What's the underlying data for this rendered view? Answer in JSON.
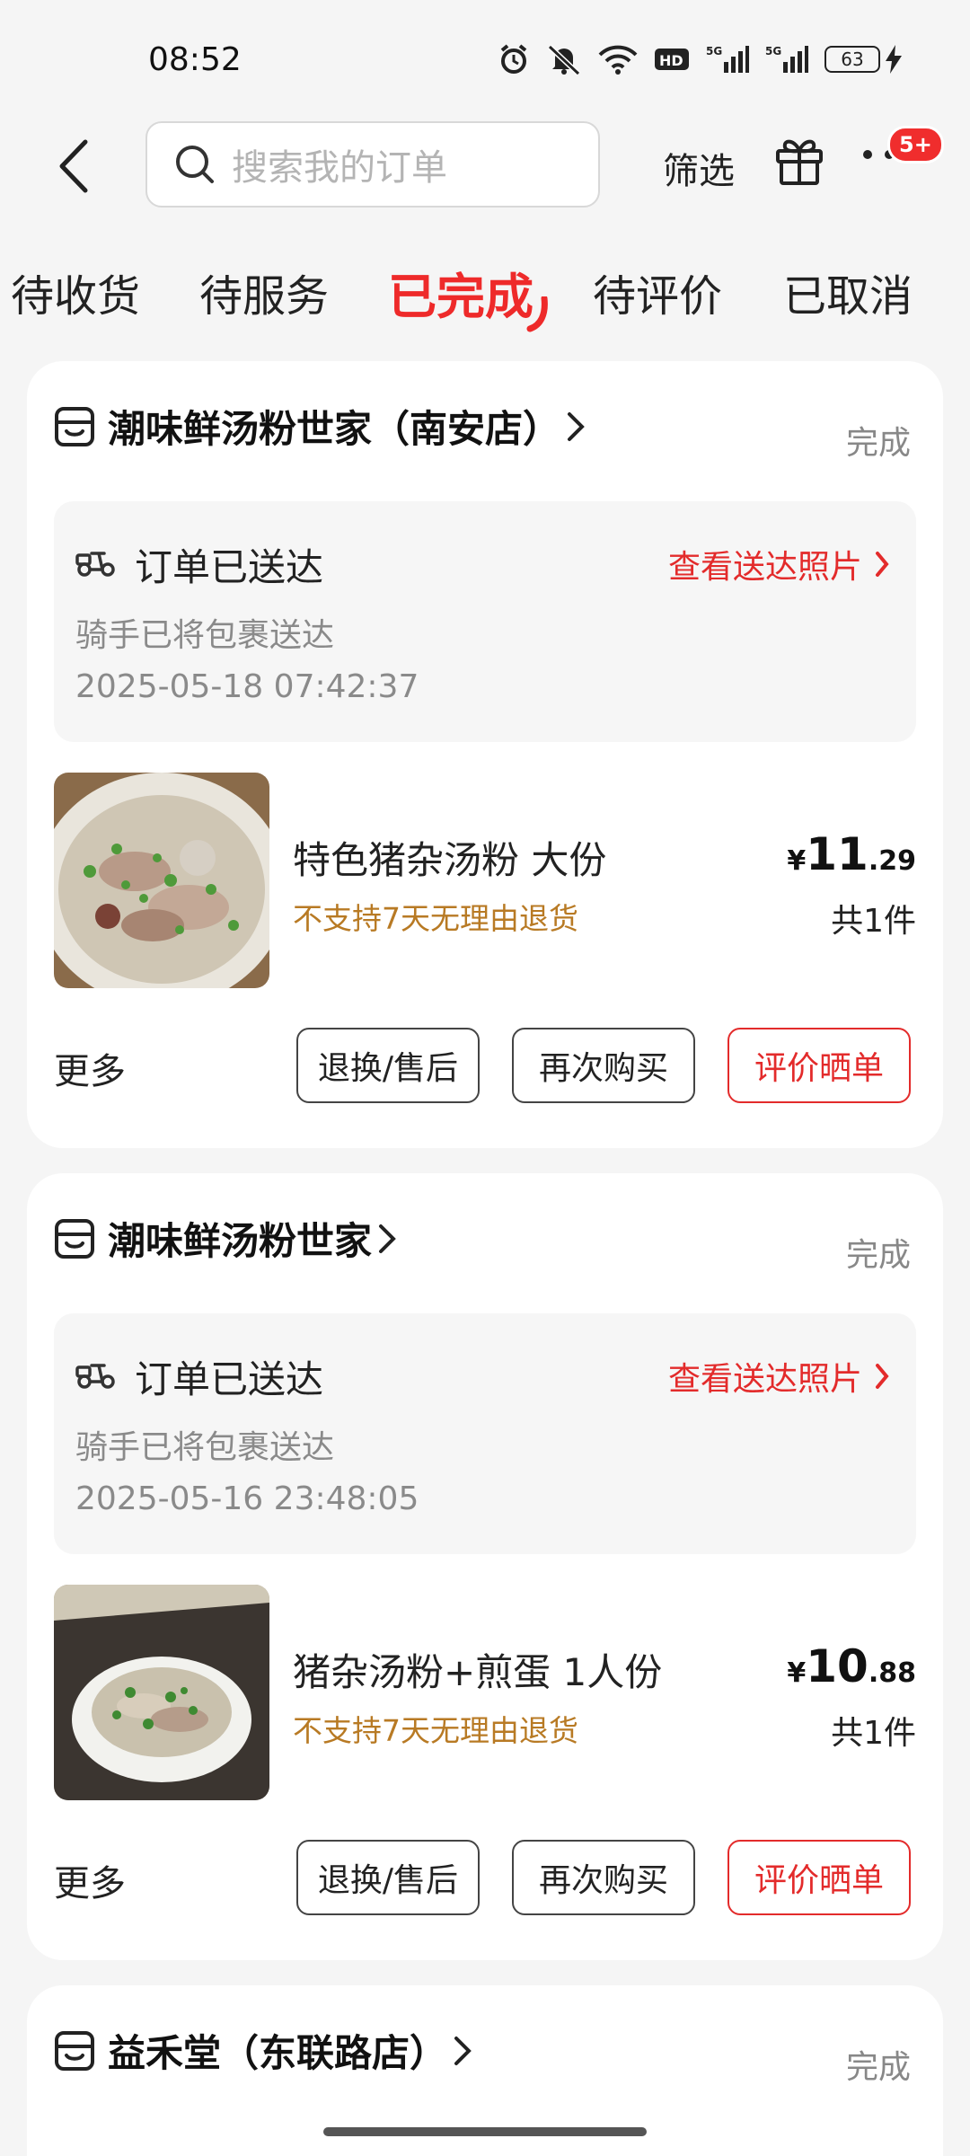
{
  "status_bar": {
    "time": "08:52",
    "battery": "63"
  },
  "header": {
    "search_placeholder": "搜索我的订单",
    "filter_label": "筛选",
    "badge": "5+"
  },
  "tabs": [
    "待收货",
    "待服务",
    "已完成",
    "待评价",
    "已取消"
  ],
  "orders": [
    {
      "shop": "潮味鲜汤粉世家（南安店）",
      "status": "完成",
      "delivery_title": "订单已送达",
      "photo_link": "查看送达照片",
      "delivery_sub": "骑手已将包裹送达",
      "delivery_time": "2025-05-18 07:42:37",
      "product": "特色猪杂汤粉 大份",
      "no_return": "不支持7天无理由退货",
      "price_symbol": "¥",
      "price_int": "11",
      "price_dec": ".29",
      "qty": "共1件",
      "more": "更多",
      "btn_after_sale": "退换/售后",
      "btn_rebuy": "再次购买",
      "btn_review": "评价晒单"
    },
    {
      "shop": "潮味鲜汤粉世家",
      "status": "完成",
      "delivery_title": "订单已送达",
      "photo_link": "查看送达照片",
      "delivery_sub": "骑手已将包裹送达",
      "delivery_time": "2025-05-16 23:48:05",
      "product": "猪杂汤粉+煎蛋 1人份",
      "no_return": "不支持7天无理由退货",
      "price_symbol": "¥",
      "price_int": "10",
      "price_dec": ".88",
      "qty": "共1件",
      "more": "更多",
      "btn_after_sale": "退换/售后",
      "btn_rebuy": "再次购买",
      "btn_review": "评价晒单"
    },
    {
      "shop": "益禾堂（东联路店）",
      "status": "完成"
    }
  ],
  "colors": {
    "accent": "#e32b2b",
    "warning_text": "#b87a24",
    "muted": "#8a8a8a"
  }
}
